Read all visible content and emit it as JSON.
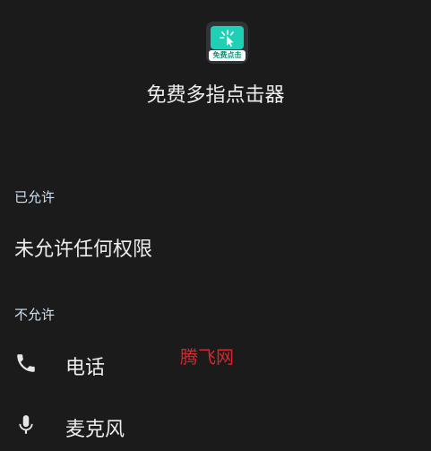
{
  "app": {
    "icon_banner_text": "免费点击",
    "title": "免费多指点击器"
  },
  "allowed": {
    "header": "已允许",
    "empty_text": "未允许任何权限"
  },
  "denied": {
    "header": "不允许",
    "items": [
      {
        "label": "电话",
        "icon": "phone-icon"
      },
      {
        "label": "麦克风",
        "icon": "microphone-icon"
      }
    ]
  },
  "watermark": "腾飞网",
  "colors": {
    "background": "#1b1b1b",
    "icon_teal": "#1fd0b6",
    "watermark_red": "#d8262b"
  }
}
